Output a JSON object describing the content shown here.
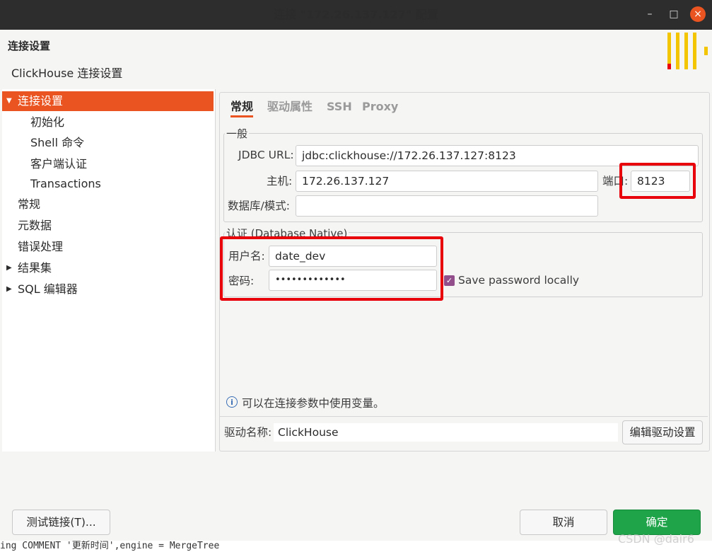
{
  "window": {
    "title": "连接 \"172.26.137.127\" 配置",
    "minimize": "–",
    "maximize": "□",
    "close": "×"
  },
  "header": {
    "title": "连接设置",
    "subtitle": "ClickHouse 连接设置"
  },
  "sidebar": {
    "items": [
      {
        "label": "连接设置",
        "selected": true
      },
      {
        "label": "初始化"
      },
      {
        "label": "Shell 命令"
      },
      {
        "label": "客户端认证"
      },
      {
        "label": "Transactions"
      },
      {
        "label": "常规"
      },
      {
        "label": "元数据"
      },
      {
        "label": "错误处理"
      },
      {
        "label": "结果集"
      },
      {
        "label": "SQL 编辑器"
      }
    ]
  },
  "tabs": [
    "常规",
    "驱动属性",
    "SSH",
    "Proxy"
  ],
  "general": {
    "group_title": "一般",
    "jdbc_label": "JDBC URL:",
    "jdbc_value": "jdbc:clickhouse://172.26.137.127:8123",
    "host_label": "主机:",
    "host_value": "172.26.137.127",
    "port_label": "端口:",
    "port_value": "8123",
    "db_label": "数据库/模式:",
    "db_value": ""
  },
  "auth": {
    "group_title": "认证 (Database Native)",
    "user_label": "用户名:",
    "user_value": "date_dev",
    "password_label": "密码:",
    "password_value": "•••••••••••••",
    "save_password_label": "Save password locally",
    "save_password_checked": true
  },
  "info_text": "可以在连接参数中使用变量。",
  "driver": {
    "label": "驱动名称:",
    "value": "ClickHouse",
    "edit_button": "编辑驱动设置"
  },
  "footer": {
    "test_button": "测试链接(T)...",
    "cancel_button": "取消",
    "ok_button": "确定"
  },
  "background_text": "ing COMMENT '更新时间',engine = MergeTree",
  "watermark": "CSDN @dair6",
  "colors": {
    "accent": "#e95420",
    "ok": "#1fa44a",
    "highlight": "#e8000b",
    "logo": "#f3c500"
  }
}
